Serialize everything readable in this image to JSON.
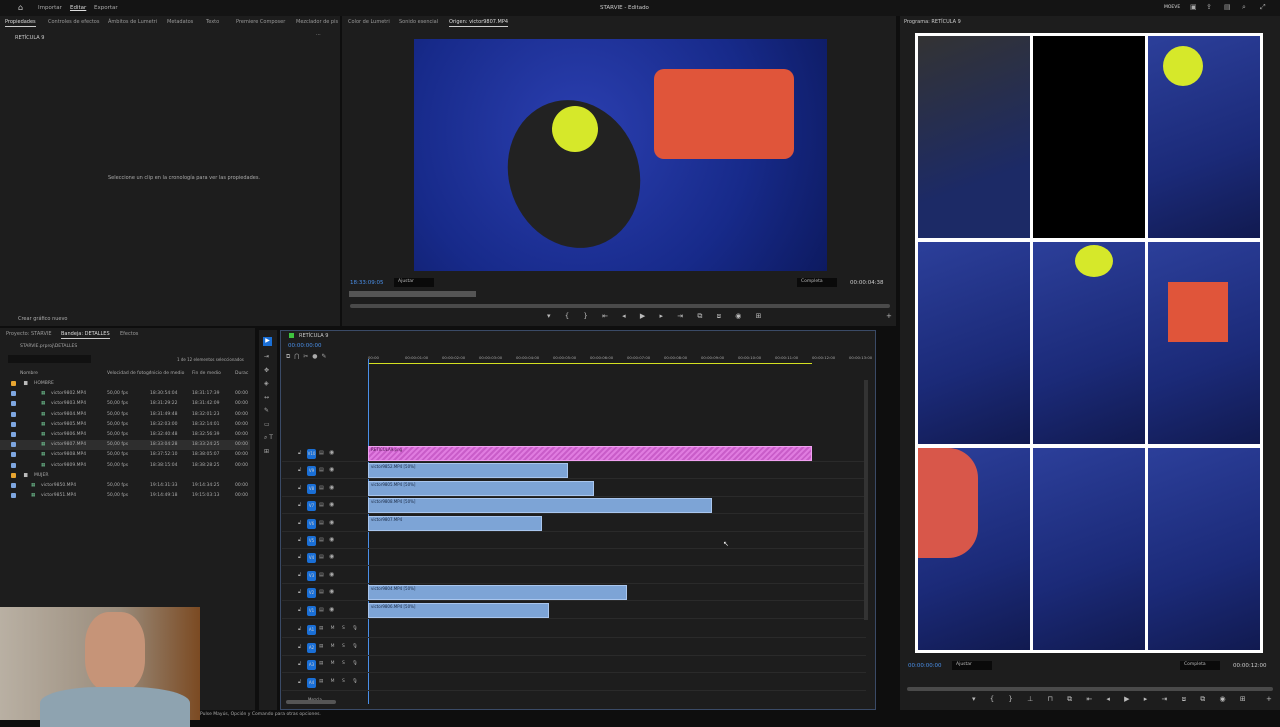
{
  "topbar": {
    "menu": [
      "Importar",
      "Editar",
      "Exportar"
    ],
    "active": "Editar",
    "title": "STARVIE - Editado",
    "right_label": "MOEVE"
  },
  "properties": {
    "tabs": [
      "Propiedades",
      "Controles de efectos",
      "Ámbitos de Lumetri",
      "Metadatos",
      "Texto",
      "Premiere Composer",
      "Mezclador de pis"
    ],
    "header": "RETÍCULA 9",
    "empty_message": "Seleccione un clip en la cronología para ver las propiedades.",
    "footer": "Crear gráfico nuevo"
  },
  "source": {
    "tabs": [
      "Color de Lumetri",
      "Sonido esencial",
      "Origen: victor9807.MP4"
    ],
    "timecode": "18:33:09:05",
    "fit": "Ajustar",
    "quality": "Completa",
    "duration": "00:00:04:38",
    "progress": 0.23
  },
  "program": {
    "title": "Programa: RETÍCULA 9",
    "timecode": "00:00:00:00",
    "fit": "Ajustar",
    "quality": "Completa",
    "duration": "00:00:12:00"
  },
  "project": {
    "tabs": [
      "Proyecto: STARVIE",
      "Bandeja: DETALLES",
      "Efectos"
    ],
    "path": "STARVIE.prproj\\DETALLES",
    "selection": "1 de 12 elementos seleccionados",
    "columns": [
      "Nombre",
      "Velocidad de fotogr",
      "Inicio de medio",
      "Fin de medio",
      "Durac"
    ],
    "rows": [
      {
        "name": "HOMBRE",
        "type": "folder",
        "open": true
      },
      {
        "name": "victor9802.MP4",
        "fps": "50,00 fps",
        "start": "18:30:54:04",
        "end": "18:31:17:39",
        "dur": "00:00"
      },
      {
        "name": "victor9803.MP4",
        "fps": "50,00 fps",
        "start": "18:31:29:22",
        "end": "18:31:42:09",
        "dur": "00:00"
      },
      {
        "name": "victor9804.MP4",
        "fps": "50,00 fps",
        "start": "18:31:49:48",
        "end": "18:32:01:23",
        "dur": "00:00"
      },
      {
        "name": "victor9805.MP4",
        "fps": "50,00 fps",
        "start": "18:32:03:00",
        "end": "18:32:14:01",
        "dur": "00:00"
      },
      {
        "name": "victor9806.MP4",
        "fps": "50,00 fps",
        "start": "18:32:40:48",
        "end": "18:32:56:39",
        "dur": "00:00"
      },
      {
        "name": "victor9807.MP4",
        "fps": "50,00 fps",
        "start": "18:33:04:28",
        "end": "18:33:24:25",
        "dur": "00:00",
        "selected": true
      },
      {
        "name": "victor9808.MP4",
        "fps": "50,00 fps",
        "start": "18:37:52:10",
        "end": "18:38:05:07",
        "dur": "00:00"
      },
      {
        "name": "victor9809.MP4",
        "fps": "50,00 fps",
        "start": "18:38:15:04",
        "end": "18:38:28:25",
        "dur": "00:00"
      },
      {
        "name": "MUJER",
        "type": "folder",
        "open": false
      },
      {
        "name": "victor9850.MP4",
        "fps": "50,00 fps",
        "start": "19:14:31:33",
        "end": "19:14:34:25",
        "dur": "00:00"
      },
      {
        "name": "victor9851.MP4",
        "fps": "50,00 fps",
        "start": "19:14:49:18",
        "end": "19:15:03:13",
        "dur": "00:00"
      }
    ]
  },
  "timeline": {
    "title": "RETÍCULA 9",
    "timecode": "00:00:00:00",
    "ruler": [
      "00:00",
      "00:00:01:00",
      "00:00:02:00",
      "00:00:03:00",
      "00:00:04:00",
      "00:00:05:00",
      "00:00:06:00",
      "00:00:07:00",
      "00:00:08:00",
      "00:00:09:00",
      "00:00:10:00",
      "00:00:11:00",
      "00:00:12:00",
      "00:00:13:00"
    ],
    "tracks": [
      {
        "name": "V10",
        "clip": {
          "name": "RETICULA9.png",
          "end": 12,
          "kind": "graphic"
        }
      },
      {
        "name": "V9",
        "clip": {
          "name": "victor9852.MP4 [50%]",
          "end": 5.4
        }
      },
      {
        "name": "V8",
        "clip": {
          "name": "victor9805.MP4 [50%]",
          "end": 6.1
        }
      },
      {
        "name": "V7",
        "clip": {
          "name": "victor9808.MP4 [50%]",
          "end": 9.3
        }
      },
      {
        "name": "V6",
        "clip": {
          "name": "victor9807.MP4",
          "end": 4.7
        }
      },
      {
        "name": "V5"
      },
      {
        "name": "V4"
      },
      {
        "name": "V3"
      },
      {
        "name": "V2",
        "clip": {
          "name": "victor9804.MP4 [50%]",
          "end": 7.0
        }
      },
      {
        "name": "V1",
        "clip": {
          "name": "victor9806.MP4 [50%]",
          "end": 4.9
        }
      }
    ],
    "audio": [
      "A1",
      "A2",
      "A3",
      "A4"
    ],
    "mix": "Mezcla"
  },
  "status": "Pulse Mayús, Opción y Comando para otras opciones.",
  "colors": {
    "accent": "#1a6fd6",
    "timecode": "#4a8fe8",
    "graphic_clip": "#e07ce0",
    "video_clip": "#7da4d6",
    "work_area": "#d4e021"
  }
}
